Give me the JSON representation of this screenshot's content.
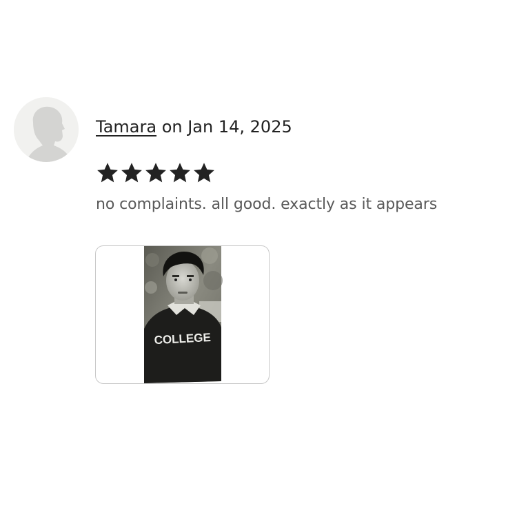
{
  "review": {
    "reviewer_name": "Tamara",
    "date_text": "on Jan 14, 2025",
    "rating": 5,
    "rating_max": 5,
    "text": "no complaints. all good. exactly as it appears"
  },
  "photo": {
    "printed_text": "COLLEGE"
  },
  "icons": {
    "avatar": "default-user-silhouette-icon",
    "star": "star-filled-icon"
  },
  "colors": {
    "text": "#222222",
    "muted_text": "#595959",
    "star": "#222222",
    "avatar_bg": "#f1f1ef",
    "avatar_figure": "#d4d4d2",
    "photo_border": "#c8c8c8"
  }
}
